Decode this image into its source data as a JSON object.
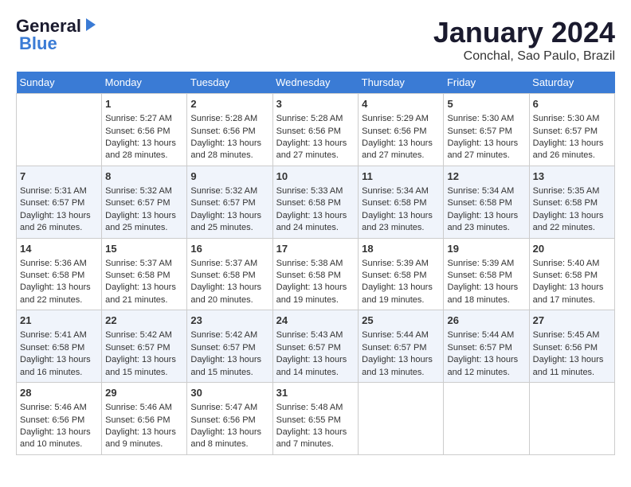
{
  "header": {
    "logo_line1": "General",
    "logo_line2": "Blue",
    "month": "January 2024",
    "location": "Conchal, Sao Paulo, Brazil"
  },
  "days_of_week": [
    "Sunday",
    "Monday",
    "Tuesday",
    "Wednesday",
    "Thursday",
    "Friday",
    "Saturday"
  ],
  "weeks": [
    [
      {
        "day": "",
        "sunrise": "",
        "sunset": "",
        "daylight": ""
      },
      {
        "day": "1",
        "sunrise": "Sunrise: 5:27 AM",
        "sunset": "Sunset: 6:56 PM",
        "daylight": "Daylight: 13 hours and 28 minutes."
      },
      {
        "day": "2",
        "sunrise": "Sunrise: 5:28 AM",
        "sunset": "Sunset: 6:56 PM",
        "daylight": "Daylight: 13 hours and 28 minutes."
      },
      {
        "day": "3",
        "sunrise": "Sunrise: 5:28 AM",
        "sunset": "Sunset: 6:56 PM",
        "daylight": "Daylight: 13 hours and 27 minutes."
      },
      {
        "day": "4",
        "sunrise": "Sunrise: 5:29 AM",
        "sunset": "Sunset: 6:56 PM",
        "daylight": "Daylight: 13 hours and 27 minutes."
      },
      {
        "day": "5",
        "sunrise": "Sunrise: 5:30 AM",
        "sunset": "Sunset: 6:57 PM",
        "daylight": "Daylight: 13 hours and 27 minutes."
      },
      {
        "day": "6",
        "sunrise": "Sunrise: 5:30 AM",
        "sunset": "Sunset: 6:57 PM",
        "daylight": "Daylight: 13 hours and 26 minutes."
      }
    ],
    [
      {
        "day": "7",
        "sunrise": "Sunrise: 5:31 AM",
        "sunset": "Sunset: 6:57 PM",
        "daylight": "Daylight: 13 hours and 26 minutes."
      },
      {
        "day": "8",
        "sunrise": "Sunrise: 5:32 AM",
        "sunset": "Sunset: 6:57 PM",
        "daylight": "Daylight: 13 hours and 25 minutes."
      },
      {
        "day": "9",
        "sunrise": "Sunrise: 5:32 AM",
        "sunset": "Sunset: 6:57 PM",
        "daylight": "Daylight: 13 hours and 25 minutes."
      },
      {
        "day": "10",
        "sunrise": "Sunrise: 5:33 AM",
        "sunset": "Sunset: 6:58 PM",
        "daylight": "Daylight: 13 hours and 24 minutes."
      },
      {
        "day": "11",
        "sunrise": "Sunrise: 5:34 AM",
        "sunset": "Sunset: 6:58 PM",
        "daylight": "Daylight: 13 hours and 23 minutes."
      },
      {
        "day": "12",
        "sunrise": "Sunrise: 5:34 AM",
        "sunset": "Sunset: 6:58 PM",
        "daylight": "Daylight: 13 hours and 23 minutes."
      },
      {
        "day": "13",
        "sunrise": "Sunrise: 5:35 AM",
        "sunset": "Sunset: 6:58 PM",
        "daylight": "Daylight: 13 hours and 22 minutes."
      }
    ],
    [
      {
        "day": "14",
        "sunrise": "Sunrise: 5:36 AM",
        "sunset": "Sunset: 6:58 PM",
        "daylight": "Daylight: 13 hours and 22 minutes."
      },
      {
        "day": "15",
        "sunrise": "Sunrise: 5:37 AM",
        "sunset": "Sunset: 6:58 PM",
        "daylight": "Daylight: 13 hours and 21 minutes."
      },
      {
        "day": "16",
        "sunrise": "Sunrise: 5:37 AM",
        "sunset": "Sunset: 6:58 PM",
        "daylight": "Daylight: 13 hours and 20 minutes."
      },
      {
        "day": "17",
        "sunrise": "Sunrise: 5:38 AM",
        "sunset": "Sunset: 6:58 PM",
        "daylight": "Daylight: 13 hours and 19 minutes."
      },
      {
        "day": "18",
        "sunrise": "Sunrise: 5:39 AM",
        "sunset": "Sunset: 6:58 PM",
        "daylight": "Daylight: 13 hours and 19 minutes."
      },
      {
        "day": "19",
        "sunrise": "Sunrise: 5:39 AM",
        "sunset": "Sunset: 6:58 PM",
        "daylight": "Daylight: 13 hours and 18 minutes."
      },
      {
        "day": "20",
        "sunrise": "Sunrise: 5:40 AM",
        "sunset": "Sunset: 6:58 PM",
        "daylight": "Daylight: 13 hours and 17 minutes."
      }
    ],
    [
      {
        "day": "21",
        "sunrise": "Sunrise: 5:41 AM",
        "sunset": "Sunset: 6:58 PM",
        "daylight": "Daylight: 13 hours and 16 minutes."
      },
      {
        "day": "22",
        "sunrise": "Sunrise: 5:42 AM",
        "sunset": "Sunset: 6:57 PM",
        "daylight": "Daylight: 13 hours and 15 minutes."
      },
      {
        "day": "23",
        "sunrise": "Sunrise: 5:42 AM",
        "sunset": "Sunset: 6:57 PM",
        "daylight": "Daylight: 13 hours and 15 minutes."
      },
      {
        "day": "24",
        "sunrise": "Sunrise: 5:43 AM",
        "sunset": "Sunset: 6:57 PM",
        "daylight": "Daylight: 13 hours and 14 minutes."
      },
      {
        "day": "25",
        "sunrise": "Sunrise: 5:44 AM",
        "sunset": "Sunset: 6:57 PM",
        "daylight": "Daylight: 13 hours and 13 minutes."
      },
      {
        "day": "26",
        "sunrise": "Sunrise: 5:44 AM",
        "sunset": "Sunset: 6:57 PM",
        "daylight": "Daylight: 13 hours and 12 minutes."
      },
      {
        "day": "27",
        "sunrise": "Sunrise: 5:45 AM",
        "sunset": "Sunset: 6:56 PM",
        "daylight": "Daylight: 13 hours and 11 minutes."
      }
    ],
    [
      {
        "day": "28",
        "sunrise": "Sunrise: 5:46 AM",
        "sunset": "Sunset: 6:56 PM",
        "daylight": "Daylight: 13 hours and 10 minutes."
      },
      {
        "day": "29",
        "sunrise": "Sunrise: 5:46 AM",
        "sunset": "Sunset: 6:56 PM",
        "daylight": "Daylight: 13 hours and 9 minutes."
      },
      {
        "day": "30",
        "sunrise": "Sunrise: 5:47 AM",
        "sunset": "Sunset: 6:56 PM",
        "daylight": "Daylight: 13 hours and 8 minutes."
      },
      {
        "day": "31",
        "sunrise": "Sunrise: 5:48 AM",
        "sunset": "Sunset: 6:55 PM",
        "daylight": "Daylight: 13 hours and 7 minutes."
      },
      {
        "day": "",
        "sunrise": "",
        "sunset": "",
        "daylight": ""
      },
      {
        "day": "",
        "sunrise": "",
        "sunset": "",
        "daylight": ""
      },
      {
        "day": "",
        "sunrise": "",
        "sunset": "",
        "daylight": ""
      }
    ]
  ]
}
